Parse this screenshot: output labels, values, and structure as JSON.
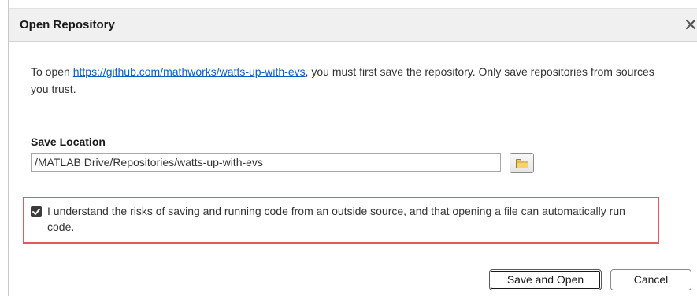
{
  "dialog": {
    "title": "Open Repository",
    "close_glyph": "✕",
    "message": {
      "prefix": "To open ",
      "link": "https://github.com/mathworks/watts-up-with-evs",
      "suffix": ", you must first save the repository. Only save repositories from sources you trust."
    },
    "save_location": {
      "label": "Save Location",
      "value": "/MATLAB Drive/Repositories/watts-up-with-evs",
      "browse_icon": "folder-icon"
    },
    "consent": {
      "checked": true,
      "text": "I understand the risks of saving and running code from an outside source, and that opening a file can automatically run code.",
      "highlight_color": "#e05a60"
    },
    "buttons": {
      "primary": "Save and Open",
      "cancel": "Cancel"
    }
  },
  "colors": {
    "link": "#0a5fc7",
    "titlebar": "#f0f0f0"
  }
}
